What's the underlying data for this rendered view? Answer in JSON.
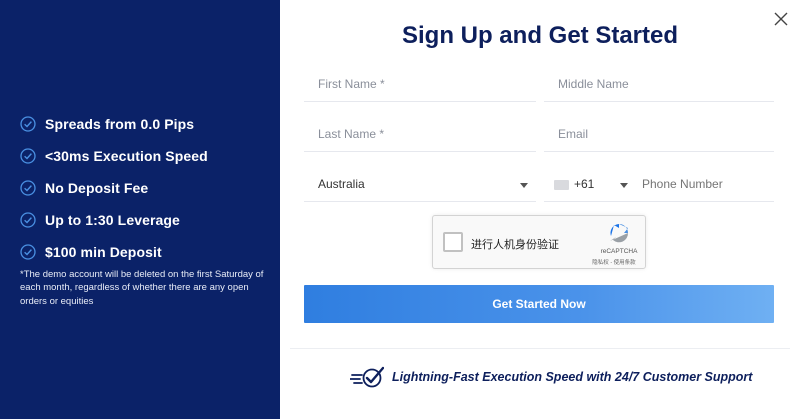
{
  "features": [
    {
      "label": "Spreads from 0.0 Pips",
      "icon": "check-circle-icon"
    },
    {
      "label": "<30ms Execution Speed",
      "icon": "check-circle-icon"
    },
    {
      "label": "No Deposit Fee",
      "icon": "check-circle-icon"
    },
    {
      "label": "Up to 1:30 Leverage",
      "icon": "check-circle-icon"
    },
    {
      "label": "$100 min Deposit",
      "icon": "check-circle-icon"
    }
  ],
  "disclaimer": "*The demo account will be deleted on the first Saturday of each month, regardless of whether there are any open orders or equities",
  "form": {
    "title": "Sign Up and Get Started",
    "first_name_placeholder": "First Name *",
    "middle_name_placeholder": "Middle Name",
    "last_name_placeholder": "Last Name *",
    "email_placeholder": "Email",
    "country_value": "Australia",
    "phone_code": "+61",
    "phone_placeholder": "Phone Number",
    "captcha_label": "进行人机身份验证",
    "captcha_brand": "reCAPTCHA",
    "captcha_links": "隐私权 - 使用条款",
    "submit_label": "Get Started Now",
    "tagline": "Lightning-Fast Execution Speed with 24/7 Customer Support"
  },
  "colors": {
    "left_panel_bg": "#0b2268",
    "title_color": "#0d1f5c",
    "cta_start": "#2f7ee0",
    "cta_end": "#6fb0f3"
  }
}
